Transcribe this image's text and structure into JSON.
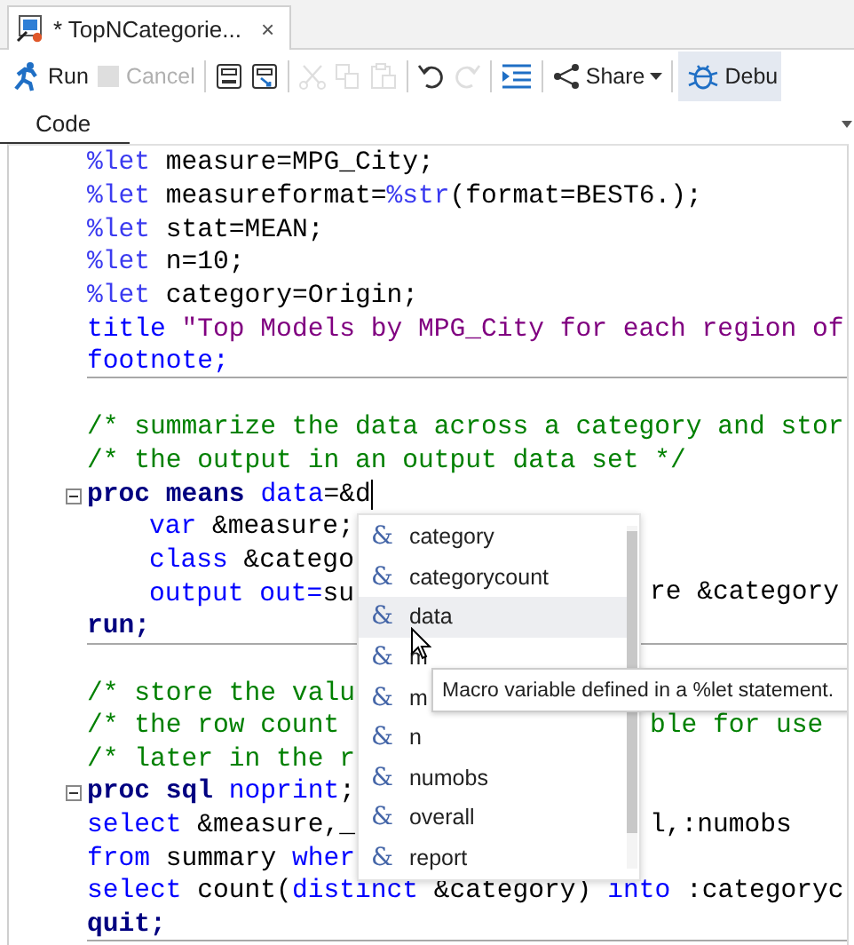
{
  "tab": {
    "title": "* TopNCategorie...",
    "close": "×"
  },
  "toolbar": [
    {
      "kind": "run",
      "label": "Run",
      "disabled": false
    },
    {
      "kind": "stop",
      "label": "Cancel",
      "disabled": true
    },
    {
      "kind": "separator"
    },
    {
      "kind": "save",
      "disabled": false
    },
    {
      "kind": "save-as",
      "disabled": false
    },
    {
      "kind": "separator"
    },
    {
      "kind": "cut",
      "disabled": true
    },
    {
      "kind": "copy",
      "disabled": true
    },
    {
      "kind": "paste",
      "disabled": true
    },
    {
      "kind": "separator"
    },
    {
      "kind": "undo",
      "disabled": false
    },
    {
      "kind": "redo",
      "disabled": true
    },
    {
      "kind": "separator"
    },
    {
      "kind": "format",
      "disabled": false
    },
    {
      "kind": "separator"
    },
    {
      "kind": "share",
      "label": "Share",
      "disabled": false
    },
    {
      "kind": "separator"
    },
    {
      "kind": "debug",
      "label": "Debu",
      "disabled": false
    }
  ],
  "section": {
    "label": "Code"
  },
  "editor": {
    "lines": [
      {
        "segs": [
          {
            "kind": "macro",
            "t": "%let"
          },
          {
            "kind": "plain",
            "t": " measure=MPG_City;"
          }
        ]
      },
      {
        "segs": [
          {
            "kind": "macro",
            "t": "%let"
          },
          {
            "kind": "plain",
            "t": " measureformat="
          },
          {
            "kind": "macro",
            "t": "%str"
          },
          {
            "kind": "plain",
            "t": "(format=BEST6.);"
          }
        ]
      },
      {
        "segs": [
          {
            "kind": "macro",
            "t": "%let"
          },
          {
            "kind": "plain",
            "t": " stat=MEAN;"
          }
        ]
      },
      {
        "segs": [
          {
            "kind": "macro",
            "t": "%let"
          },
          {
            "kind": "plain",
            "t": " n=10;"
          }
        ]
      },
      {
        "segs": [
          {
            "kind": "macro",
            "t": "%let"
          },
          {
            "kind": "plain",
            "t": " category=Origin;"
          }
        ]
      },
      {
        "segs": [
          {
            "kind": "kw",
            "t": "title "
          },
          {
            "kind": "str",
            "t": "\"Top Models by MPG_City for each region of"
          }
        ]
      },
      {
        "segs": [
          {
            "kind": "kw",
            "t": "footnote;"
          }
        ],
        "rule_below": true
      },
      {
        "blank": true
      },
      {
        "segs": [
          {
            "kind": "cmt",
            "t": "/* summarize the data across a category and stor"
          }
        ]
      },
      {
        "segs": [
          {
            "kind": "cmt",
            "t": "/* the output in an output data set */"
          }
        ]
      },
      {
        "segs": [
          {
            "kind": "proc",
            "t": "proc means "
          },
          {
            "kind": "kw",
            "t": "data"
          },
          {
            "kind": "plain",
            "t": "=&d"
          }
        ],
        "fold": true,
        "cursor": true,
        "children": [
          {
            "segs": [
              {
                "kind": "kw",
                "t": "var"
              },
              {
                "kind": "plain",
                "t": " &measure;"
              }
            ]
          },
          {
            "segs": [
              {
                "kind": "kw",
                "t": "class"
              },
              {
                "kind": "plain",
                "t": " &catego"
              }
            ]
          },
          {
            "segs": [
              {
                "kind": "kw",
                "t": "output "
              },
              {
                "kind": "kw",
                "t": "out="
              },
              {
                "kind": "plain",
                "t": "su"
              }
            ],
            "right": [
              {
                "kind": "plain",
                "t": "re &category"
              }
            ]
          }
        ]
      },
      {
        "segs": [
          {
            "kind": "proc",
            "t": "run;"
          }
        ],
        "rule_below": true
      },
      {
        "blank": true
      },
      {
        "segs": [
          {
            "kind": "cmt",
            "t": "/* store the valu"
          }
        ]
      },
      {
        "segs": [
          {
            "kind": "cmt",
            "t": "/* the row count"
          }
        ],
        "right": [
          {
            "kind": "cmt",
            "t": "ble for use"
          }
        ]
      },
      {
        "segs": [
          {
            "kind": "cmt",
            "t": "/* later in the r"
          }
        ]
      },
      {
        "segs": [
          {
            "kind": "proc",
            "t": "proc sql "
          },
          {
            "kind": "kw",
            "t": "noprint"
          },
          {
            "kind": "plain",
            "t": ";"
          }
        ],
        "fold": true
      },
      {
        "segs": [
          {
            "kind": "kw",
            "t": "select"
          },
          {
            "kind": "plain",
            "t": " &measure,_"
          }
        ],
        "right": [
          {
            "kind": "plain",
            "t": "l,:numobs"
          }
        ]
      },
      {
        "segs": [
          {
            "kind": "kw",
            "t": "from"
          },
          {
            "kind": "plain",
            "t": " summary "
          },
          {
            "kind": "kw",
            "t": "wher"
          }
        ]
      },
      {
        "segs": [
          {
            "kind": "kw",
            "t": "select"
          },
          {
            "kind": "plain",
            "t": " count("
          },
          {
            "kind": "kw",
            "t": "distinct"
          },
          {
            "kind": "plain",
            "t": " &category) "
          },
          {
            "kind": "kw",
            "t": "into"
          },
          {
            "kind": "plain",
            "t": " :categoryc"
          }
        ]
      },
      {
        "segs": [
          {
            "kind": "proc",
            "t": "quit;"
          }
        ],
        "rule_below": true
      }
    ]
  },
  "completion": {
    "items": [
      {
        "symbol": "&",
        "label": "category",
        "selected": false
      },
      {
        "symbol": "&",
        "label": "categorycount",
        "selected": false
      },
      {
        "symbol": "&",
        "label": "data",
        "selected": true
      },
      {
        "symbol": "&",
        "label": "m",
        "selected": false
      },
      {
        "symbol": "&",
        "label": "m",
        "selected": false
      },
      {
        "symbol": "&",
        "label": "n",
        "selected": false
      },
      {
        "symbol": "&",
        "label": "numobs",
        "selected": false
      },
      {
        "symbol": "&",
        "label": "overall",
        "selected": false
      },
      {
        "symbol": "&",
        "label": "report",
        "selected": false
      }
    ],
    "tooltip": "Macro variable defined in a %let statement."
  }
}
